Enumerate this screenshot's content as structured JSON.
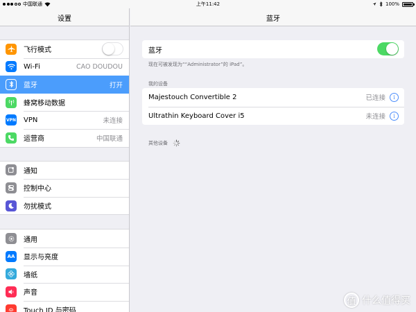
{
  "status_bar": {
    "carrier": "中国联通",
    "time": "上午11:42",
    "battery": "100%"
  },
  "settings": {
    "title": "设置",
    "group1": [
      {
        "label": "飞行模式",
        "icon": "airplane-icon",
        "color": "#ff9500"
      },
      {
        "label": "Wi-Fi",
        "value": "CAO DOUDOU",
        "icon": "wifi-icon",
        "color": "#007aff"
      },
      {
        "label": "蓝牙",
        "value": "打开",
        "icon": "bluetooth-icon",
        "color": "#007aff"
      },
      {
        "label": "蜂窝移动数据",
        "icon": "cellular-icon",
        "color": "#4cd964"
      },
      {
        "label": "VPN",
        "value": "未连接",
        "icon": "vpn-icon",
        "color": "#007aff"
      },
      {
        "label": "运营商",
        "value": "中国联通",
        "icon": "phone-icon",
        "color": "#4cd964"
      }
    ],
    "group2": [
      {
        "label": "通知",
        "icon": "notifications-icon",
        "color": "#8e8e93"
      },
      {
        "label": "控制中心",
        "icon": "control-center-icon",
        "color": "#8e8e93"
      },
      {
        "label": "勿扰模式",
        "icon": "moon-icon",
        "color": "#5856d6"
      }
    ],
    "group3": [
      {
        "label": "通用",
        "icon": "gear-icon",
        "color": "#8e8e93"
      },
      {
        "label": "显示与亮度",
        "icon": "display-icon",
        "color": "#007aff"
      },
      {
        "label": "墙纸",
        "icon": "wallpaper-icon",
        "color": "#34aadc"
      },
      {
        "label": "声音",
        "icon": "sound-icon",
        "color": "#ff2d55"
      },
      {
        "label": "Touch ID 与密码",
        "icon": "fingerprint-icon",
        "color": "#ff3b30"
      }
    ]
  },
  "bluetooth": {
    "title": "蓝牙",
    "toggle_label": "蓝牙",
    "toggle_on": true,
    "discoverable_hint": "现在可被发现为““Administrator”的 iPad”。",
    "my_devices_header": "我的设备",
    "devices": [
      {
        "name": "Majestouch Convertible 2",
        "status": "已连接"
      },
      {
        "name": "Ultrathin Keyboard Cover i5",
        "status": "未连接"
      }
    ],
    "other_devices_header": "其他设备"
  },
  "watermark": {
    "logo": "值",
    "text": "什么值得买"
  },
  "colors": {
    "accent": "#4b9dfc",
    "toggle_on": "#4cd964",
    "info_blue": "#4b8dfb"
  }
}
